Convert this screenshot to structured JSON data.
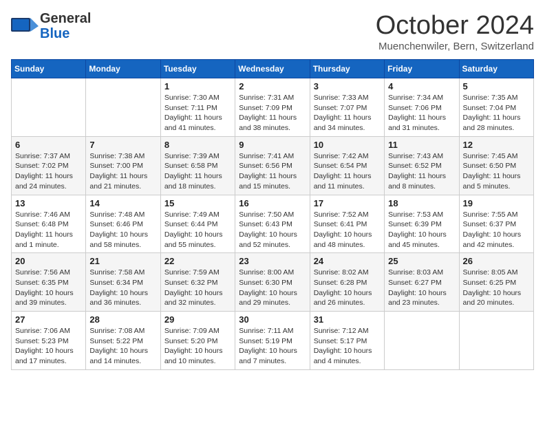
{
  "header": {
    "logo_general": "General",
    "logo_blue": "Blue",
    "month_title": "October 2024",
    "location": "Muenchenwiler, Bern, Switzerland"
  },
  "days_of_week": [
    "Sunday",
    "Monday",
    "Tuesday",
    "Wednesday",
    "Thursday",
    "Friday",
    "Saturday"
  ],
  "weeks": [
    [
      {
        "day": "",
        "info": ""
      },
      {
        "day": "",
        "info": ""
      },
      {
        "day": "1",
        "info": "Sunrise: 7:30 AM\nSunset: 7:11 PM\nDaylight: 11 hours and 41 minutes."
      },
      {
        "day": "2",
        "info": "Sunrise: 7:31 AM\nSunset: 7:09 PM\nDaylight: 11 hours and 38 minutes."
      },
      {
        "day": "3",
        "info": "Sunrise: 7:33 AM\nSunset: 7:07 PM\nDaylight: 11 hours and 34 minutes."
      },
      {
        "day": "4",
        "info": "Sunrise: 7:34 AM\nSunset: 7:06 PM\nDaylight: 11 hours and 31 minutes."
      },
      {
        "day": "5",
        "info": "Sunrise: 7:35 AM\nSunset: 7:04 PM\nDaylight: 11 hours and 28 minutes."
      }
    ],
    [
      {
        "day": "6",
        "info": "Sunrise: 7:37 AM\nSunset: 7:02 PM\nDaylight: 11 hours and 24 minutes."
      },
      {
        "day": "7",
        "info": "Sunrise: 7:38 AM\nSunset: 7:00 PM\nDaylight: 11 hours and 21 minutes."
      },
      {
        "day": "8",
        "info": "Sunrise: 7:39 AM\nSunset: 6:58 PM\nDaylight: 11 hours and 18 minutes."
      },
      {
        "day": "9",
        "info": "Sunrise: 7:41 AM\nSunset: 6:56 PM\nDaylight: 11 hours and 15 minutes."
      },
      {
        "day": "10",
        "info": "Sunrise: 7:42 AM\nSunset: 6:54 PM\nDaylight: 11 hours and 11 minutes."
      },
      {
        "day": "11",
        "info": "Sunrise: 7:43 AM\nSunset: 6:52 PM\nDaylight: 11 hours and 8 minutes."
      },
      {
        "day": "12",
        "info": "Sunrise: 7:45 AM\nSunset: 6:50 PM\nDaylight: 11 hours and 5 minutes."
      }
    ],
    [
      {
        "day": "13",
        "info": "Sunrise: 7:46 AM\nSunset: 6:48 PM\nDaylight: 11 hours and 1 minute."
      },
      {
        "day": "14",
        "info": "Sunrise: 7:48 AM\nSunset: 6:46 PM\nDaylight: 10 hours and 58 minutes."
      },
      {
        "day": "15",
        "info": "Sunrise: 7:49 AM\nSunset: 6:44 PM\nDaylight: 10 hours and 55 minutes."
      },
      {
        "day": "16",
        "info": "Sunrise: 7:50 AM\nSunset: 6:43 PM\nDaylight: 10 hours and 52 minutes."
      },
      {
        "day": "17",
        "info": "Sunrise: 7:52 AM\nSunset: 6:41 PM\nDaylight: 10 hours and 48 minutes."
      },
      {
        "day": "18",
        "info": "Sunrise: 7:53 AM\nSunset: 6:39 PM\nDaylight: 10 hours and 45 minutes."
      },
      {
        "day": "19",
        "info": "Sunrise: 7:55 AM\nSunset: 6:37 PM\nDaylight: 10 hours and 42 minutes."
      }
    ],
    [
      {
        "day": "20",
        "info": "Sunrise: 7:56 AM\nSunset: 6:35 PM\nDaylight: 10 hours and 39 minutes."
      },
      {
        "day": "21",
        "info": "Sunrise: 7:58 AM\nSunset: 6:34 PM\nDaylight: 10 hours and 36 minutes."
      },
      {
        "day": "22",
        "info": "Sunrise: 7:59 AM\nSunset: 6:32 PM\nDaylight: 10 hours and 32 minutes."
      },
      {
        "day": "23",
        "info": "Sunrise: 8:00 AM\nSunset: 6:30 PM\nDaylight: 10 hours and 29 minutes."
      },
      {
        "day": "24",
        "info": "Sunrise: 8:02 AM\nSunset: 6:28 PM\nDaylight: 10 hours and 26 minutes."
      },
      {
        "day": "25",
        "info": "Sunrise: 8:03 AM\nSunset: 6:27 PM\nDaylight: 10 hours and 23 minutes."
      },
      {
        "day": "26",
        "info": "Sunrise: 8:05 AM\nSunset: 6:25 PM\nDaylight: 10 hours and 20 minutes."
      }
    ],
    [
      {
        "day": "27",
        "info": "Sunrise: 7:06 AM\nSunset: 5:23 PM\nDaylight: 10 hours and 17 minutes."
      },
      {
        "day": "28",
        "info": "Sunrise: 7:08 AM\nSunset: 5:22 PM\nDaylight: 10 hours and 14 minutes."
      },
      {
        "day": "29",
        "info": "Sunrise: 7:09 AM\nSunset: 5:20 PM\nDaylight: 10 hours and 10 minutes."
      },
      {
        "day": "30",
        "info": "Sunrise: 7:11 AM\nSunset: 5:19 PM\nDaylight: 10 hours and 7 minutes."
      },
      {
        "day": "31",
        "info": "Sunrise: 7:12 AM\nSunset: 5:17 PM\nDaylight: 10 hours and 4 minutes."
      },
      {
        "day": "",
        "info": ""
      },
      {
        "day": "",
        "info": ""
      }
    ]
  ]
}
